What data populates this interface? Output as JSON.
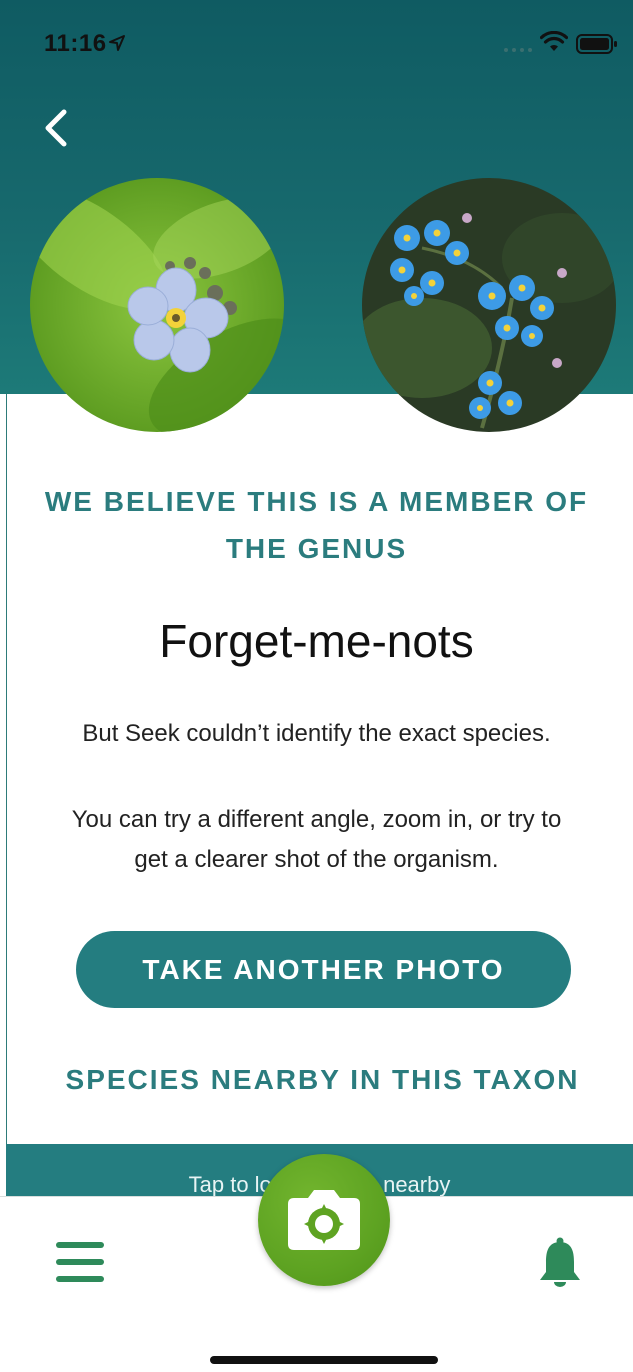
{
  "status_bar": {
    "time": "11:16",
    "icons": [
      "location-arrow-icon",
      "signal-dots-icon",
      "wifi-icon",
      "battery-icon"
    ]
  },
  "header": {
    "back_icon": "chevron-left-icon",
    "photos": [
      {
        "name": "user-photo",
        "alt": "pale blue forget-me-not close-up"
      },
      {
        "name": "reference-photo",
        "alt": "bright blue forget-me-not cluster"
      }
    ]
  },
  "result": {
    "headline": "WE BELIEVE THIS IS A MEMBER OF THE GENUS",
    "genus": "Forget-me-nots",
    "message": "But Seek couldn’t identify the exact species.",
    "advice": "You can try a different angle, zoom in, or try to get a clearer shot of the organism."
  },
  "actions": {
    "take_photo_label": "TAKE ANOTHER PHOTO"
  },
  "nearby": {
    "title": "SPECIES NEARBY IN THIS TAXON",
    "tap_text": "Tap to load species nearby"
  },
  "tabbar": {
    "menu_icon": "hamburger-menu-icon",
    "camera_icon": "camera-icon",
    "notifications_icon": "bell-icon"
  },
  "colors": {
    "teal_dark": "#0f5b62",
    "teal_accent": "#247d80",
    "heading_teal": "#2b7c7e",
    "camera_green": "#5ea322",
    "icon_green": "#2e8a5a"
  }
}
